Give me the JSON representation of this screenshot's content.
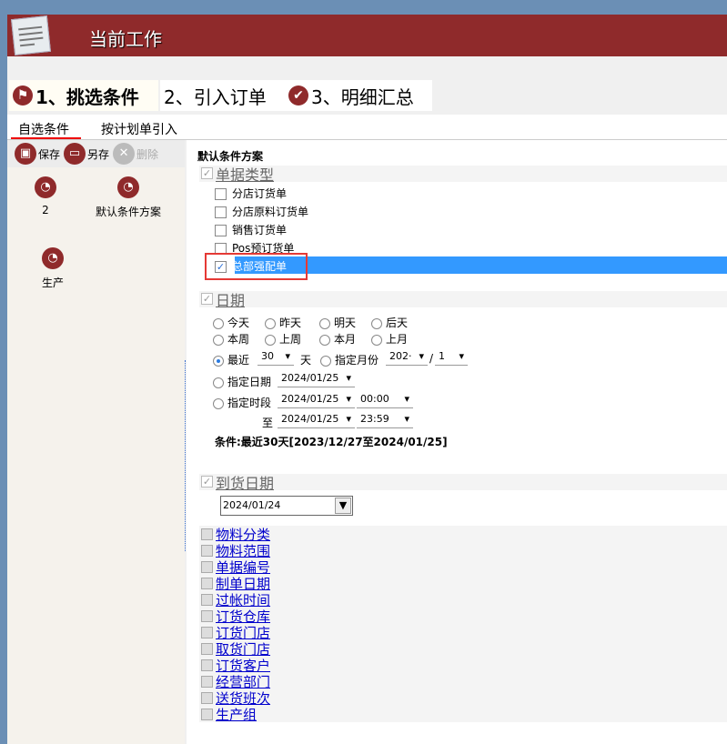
{
  "header": {
    "title": "当前工作"
  },
  "steps": [
    {
      "label": "1、挑选条件"
    },
    {
      "label": "2、引入订单"
    },
    {
      "label": "3、明细汇总"
    }
  ],
  "subtabs": [
    {
      "label": "自选条件"
    },
    {
      "label": "按计划单引入"
    }
  ],
  "toolbar": {
    "save": "保存",
    "save_as": "另存",
    "delete": "删除"
  },
  "plans": [
    {
      "label": "2"
    },
    {
      "label": "默认条件方案"
    },
    {
      "label": "生产"
    }
  ],
  "panel": {
    "title": "默认条件方案"
  },
  "doc_type": {
    "label": "单据类型",
    "items": [
      {
        "label": "分店订货单",
        "checked": false
      },
      {
        "label": "分店原料订货单",
        "checked": false
      },
      {
        "label": "销售订货单",
        "checked": false
      },
      {
        "label": "Pos预订货单",
        "checked": false
      },
      {
        "label": "总部强配单",
        "checked": true
      }
    ]
  },
  "date": {
    "label": "日期",
    "options": [
      "今天",
      "昨天",
      "明天",
      "后天",
      "本周",
      "上周",
      "本月",
      "上月"
    ],
    "recent_label": "最近",
    "recent_value": "30",
    "day_unit": "天",
    "month_label": "指定月份",
    "year_value": "202·",
    "slash": "/",
    "month_value": "1",
    "spec_date_label": "指定日期",
    "spec_date": "2024/01/25",
    "period_label": "指定时段",
    "period_from_date": "2024/01/25",
    "period_from_time": "00:00",
    "to_label": "至",
    "period_to_date": "2024/01/25",
    "period_to_time": "23:59",
    "condition": "条件:最近30天[2023/12/27至2024/01/25]"
  },
  "arrival": {
    "label": "到货日期",
    "value": "2024/01/24"
  },
  "filters": [
    "物料分类",
    "物料范围",
    "单据编号",
    "制单日期",
    "过帐时间",
    "订货仓库",
    "订货门店",
    "取货门店",
    "订货客户",
    "经营部门",
    "送货班次",
    "生产组"
  ],
  "colors": {
    "header": "#8f2a2b",
    "selection": "#3399ff",
    "highlight_box": "#e53935"
  }
}
